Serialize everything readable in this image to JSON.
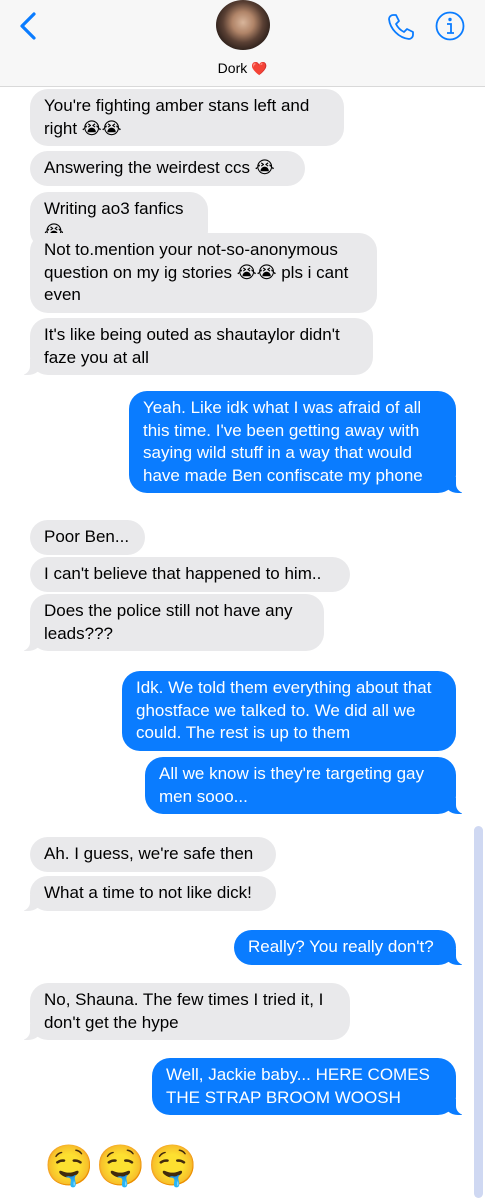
{
  "header": {
    "contact_name": "Dork",
    "heart": "❤️",
    "back_icon": "chevron-left-icon",
    "call_icon": "phone-icon",
    "info_icon": "info-icon",
    "accent": "#0a7cff"
  },
  "messages": [
    {
      "dir": "in",
      "text": "You're fighting amber stans left and right 😭😭"
    },
    {
      "dir": "in",
      "text": "Answering the weirdest ccs 😭"
    },
    {
      "dir": "in",
      "text": "Writing ao3 fanfics 😭"
    },
    {
      "dir": "in",
      "text": "Not to.mention your not-so-anonymous question on my ig stories 😭😭 pls i cant even"
    },
    {
      "dir": "in",
      "text": "It's like being outed as shautaylor didn't faze you at all"
    },
    {
      "dir": "out",
      "text": "Yeah. Like idk what I was afraid of all this time. I've been getting away with saying wild stuff in a way that would have made Ben confiscate my phone"
    },
    {
      "dir": "in",
      "text": "Poor Ben..."
    },
    {
      "dir": "in",
      "text": "I can't believe that happened to him.."
    },
    {
      "dir": "in",
      "text": "Does the police still not have any leads???"
    },
    {
      "dir": "out",
      "text": "Idk. We told them everything about that ghostface we talked to. We did all we could. The rest is up to them"
    },
    {
      "dir": "out",
      "text": "All we know is they're targeting gay men sooo..."
    },
    {
      "dir": "in",
      "text": "Ah. I guess, we're safe then"
    },
    {
      "dir": "in",
      "text": "What a time to not like dick!"
    },
    {
      "dir": "out",
      "text": "Really? You really don't?"
    },
    {
      "dir": "in",
      "text": "No, Shauna. The few times I tried it, I don't get the hype"
    },
    {
      "dir": "out",
      "text": "Well, Jackie baby... HERE COMES THE STRAP BROOM WOOSH"
    },
    {
      "dir": "out",
      "text": "🤤🤤🤤"
    }
  ],
  "colors": {
    "incoming_bubble": "#e9e9eb",
    "outgoing_bubble": "#0a7cff",
    "header_bg": "#f7f7f7"
  }
}
